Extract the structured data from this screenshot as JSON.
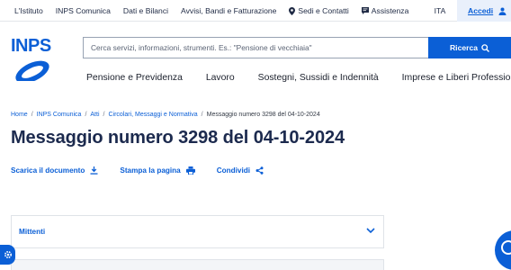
{
  "topbar": {
    "links": [
      "L'Istituto",
      "INPS Comunica",
      "Dati e Bilanci",
      "Avvisi, Bandi e Fatturazione",
      "Sedi e Contatti",
      "Assistenza"
    ],
    "language": "ITA",
    "login": "Accedi"
  },
  "header": {
    "logo_text": "INPS",
    "search_placeholder": "Cerca servizi, informazioni, strumenti. Es.: \"Pensione di vecchiaia\"",
    "search_button": "Ricerca"
  },
  "nav": {
    "items": [
      "Pensione e Previdenza",
      "Lavoro",
      "Sostegni, Sussidi e Indennità",
      "Imprese e Liberi Professionisti"
    ]
  },
  "breadcrumb": {
    "items": [
      "Home",
      "INPS Comunica",
      "Atti",
      "Circolari, Messaggi e Normativa",
      "Messaggio numero 3298 del 04-10-2024"
    ],
    "separator": "/"
  },
  "page": {
    "title": "Messaggio numero 3298 del 04-10-2024"
  },
  "actions": {
    "download": "Scarica il documento",
    "print": "Stampa la pagina",
    "share": "Condividi"
  },
  "accordion": {
    "label": "Mittenti"
  },
  "colors": {
    "primary": "#0b5fd6",
    "title": "#1c2a4e",
    "login_bg": "#e9f0fb"
  },
  "icons": {
    "location": "map-pin-icon",
    "assistance": "chat-icon",
    "login": "user-icon",
    "search": "search-icon",
    "download": "download-icon",
    "print": "printer-icon",
    "share": "share-icon",
    "chevron": "chevron-down-icon",
    "settings": "gear-icon"
  }
}
